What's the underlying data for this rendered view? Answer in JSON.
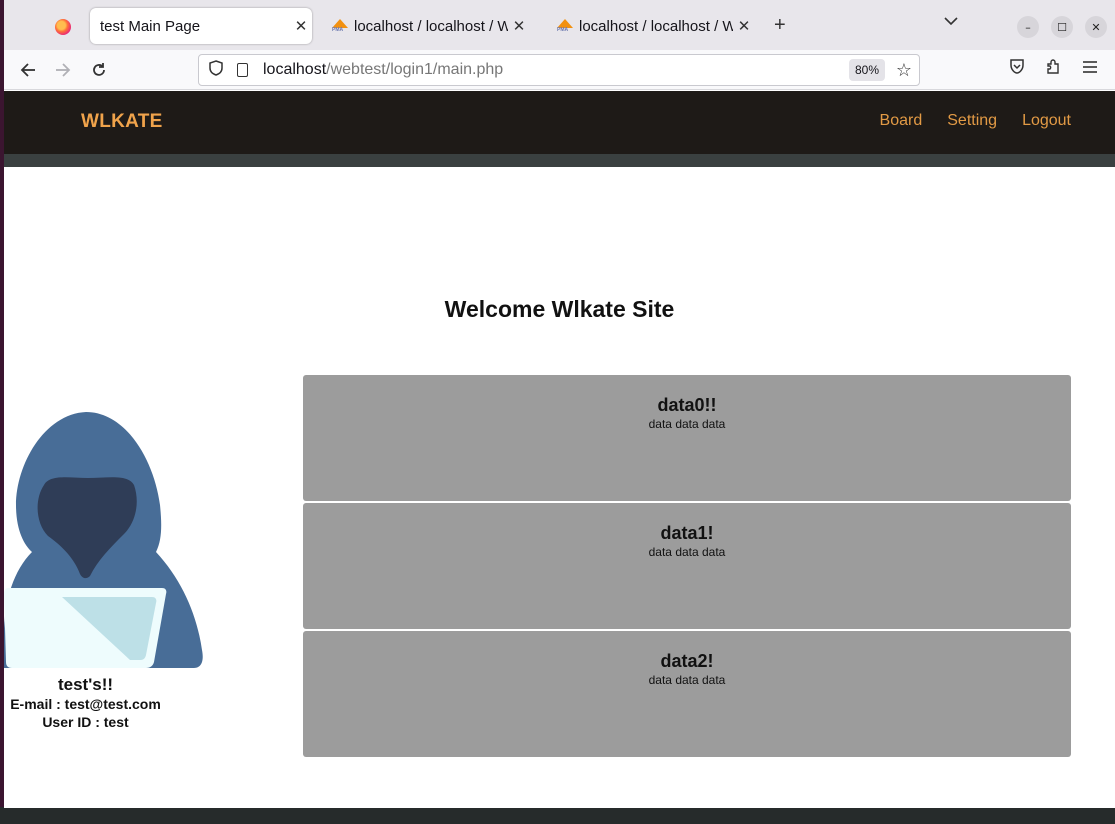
{
  "browser": {
    "tabs": [
      {
        "label": "test Main Page",
        "close": "✕"
      },
      {
        "label": "localhost / localhost / We",
        "close": "✕"
      },
      {
        "label": "localhost / localhost / We",
        "close": "✕"
      }
    ],
    "new_tab": "+",
    "tab_list": "⌄",
    "window_controls": {
      "minimize": "–",
      "maximize": "☐",
      "close": "✕"
    },
    "url_host": "localhost",
    "url_path": "/webtest/login1/main.php",
    "zoom": "80%",
    "icons": {
      "back": "back-arrow-icon",
      "forward": "forward-arrow-icon",
      "reload": "reload-icon",
      "shield": "tracking-protection-shield-icon",
      "page": "page-info-icon",
      "bookmark": "bookmark-star-icon",
      "pocket": "pocket-icon",
      "extensions": "extensions-icon",
      "menu": "hamburger-menu-icon"
    }
  },
  "site": {
    "brand": "WLKATE",
    "nav": [
      "Board",
      "Setting",
      "Logout"
    ],
    "welcome": "Welcome Wlkate Site",
    "profile": {
      "name": "test's!!",
      "email": "E-mail : test@test.com",
      "user_id": "User ID : test"
    },
    "cards": [
      {
        "title": "data0!!",
        "text": "data data data"
      },
      {
        "title": "data1!",
        "text": "data data data"
      },
      {
        "title": "data2!",
        "text": "data data data"
      }
    ]
  },
  "colors": {
    "header_bg": "#1e1a17",
    "brand": "#f0a34b",
    "nav_link": "#e29a45",
    "card_bg": "#9c9c9c",
    "hood": "#486d97",
    "laptop": "#eefcfd"
  }
}
